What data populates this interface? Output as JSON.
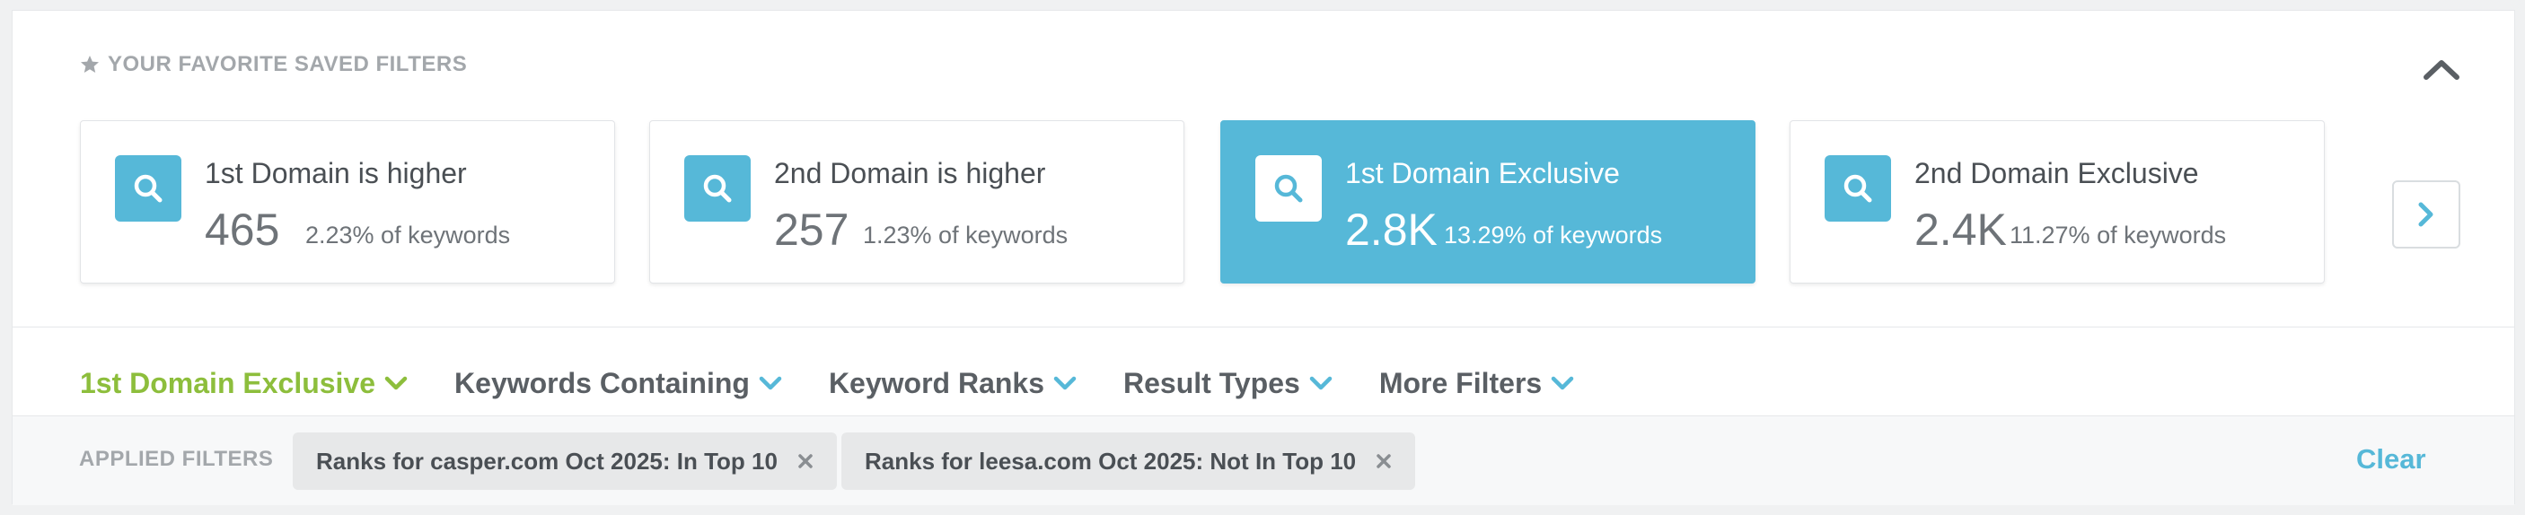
{
  "favorites": {
    "header": "YOUR FAVORITE SAVED FILTERS",
    "cards": [
      {
        "title": "1st Domain is higher",
        "number": "465",
        "percent": "2.23% of keywords",
        "active": false
      },
      {
        "title": "2nd Domain is higher",
        "number": "257",
        "percent": "1.23% of keywords",
        "active": false
      },
      {
        "title": "1st Domain Exclusive",
        "number": "2.8K",
        "percent": "13.29% of keywords",
        "active": true
      },
      {
        "title": "2nd Domain Exclusive",
        "number": "2.4K",
        "percent": "11.27% of keywords",
        "active": false
      }
    ],
    "icons": {
      "card": "search-icon",
      "collapse": "chevron-up-icon",
      "next": "chevron-right-icon",
      "header": "star-icon"
    }
  },
  "filters": [
    {
      "label": "1st Domain Exclusive",
      "active": true
    },
    {
      "label": "Keywords Containing",
      "active": false
    },
    {
      "label": "Keyword Ranks",
      "active": false
    },
    {
      "label": "Result Types",
      "active": false
    },
    {
      "label": "More Filters",
      "active": false
    }
  ],
  "applied": {
    "label": "APPLIED FILTERS",
    "chips": [
      {
        "text": "Ranks for casper.com Oct 2025: In Top 10"
      },
      {
        "text": "Ranks for leesa.com Oct 2025: Not In Top 10"
      }
    ],
    "clear_label": "Clear"
  },
  "colors": {
    "accent": "#56b8d8",
    "active_filter": "#8dbe3c",
    "text": "#4a4f54",
    "muted": "#a3a7ab"
  }
}
